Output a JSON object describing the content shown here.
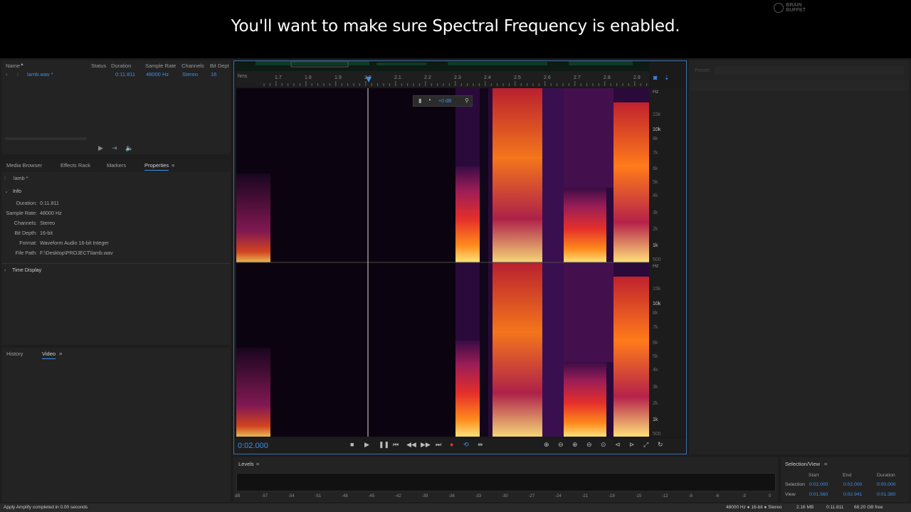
{
  "caption": "You'll want to make sure Spectral Frequency is enabled.",
  "logo": {
    "line1": "BRAIN",
    "line2": "BUFFET"
  },
  "files": {
    "columns": [
      "Name",
      "Status",
      "Duration",
      "Sample Rate",
      "Channels",
      "Bit Dept"
    ],
    "rows": [
      {
        "name": "lamb.wav *",
        "status": "",
        "duration": "0:11.811",
        "sample_rate": "48000 Hz",
        "channels": "Stereo",
        "bit_depth": "16"
      }
    ]
  },
  "tabs": [
    "Media Browser",
    "Effects Rack",
    "Markers",
    "Properties"
  ],
  "active_tab": "Properties",
  "properties": {
    "file_label": "lamb *",
    "info_header": "Info",
    "info": [
      {
        "label": "Duration:",
        "value": "0:11.811"
      },
      {
        "label": "Sample Rate:",
        "value": "48000 Hz"
      },
      {
        "label": "Channels:",
        "value": "Stereo"
      },
      {
        "label": "Bit Depth:",
        "value": "16-bit"
      },
      {
        "label": "Format:",
        "value": "Waveform Audio 16-bit Integer"
      },
      {
        "label": "File Path:",
        "value": "F:\\Desktop\\PROJECT\\lamb.wav"
      }
    ],
    "time_display": "Time Display"
  },
  "bottom_tabs": [
    "History",
    "Video"
  ],
  "ruler": {
    "unit": "hms",
    "ticks": [
      "1.7",
      "1.8",
      "1.9",
      "2.0",
      "2.1",
      "2.2",
      "2.3",
      "2.4",
      "2.5",
      "2.6",
      "2.7",
      "2.8",
      "2.9"
    ]
  },
  "hud": {
    "gain": "+0 dB"
  },
  "hz_axis": {
    "unit": "Hz",
    "ticks": [
      "15k",
      "10k",
      "8k",
      "7k",
      "6k",
      "5k",
      "4k",
      "3k",
      "2k",
      "1k",
      "500"
    ]
  },
  "timecode": "0:02.000",
  "right_panel": {
    "preset_label": "Preset:"
  },
  "levels": {
    "title": "Levels",
    "scale": [
      "dB",
      "-57",
      "-54",
      "-51",
      "-48",
      "-45",
      "-42",
      "-39",
      "-36",
      "-33",
      "-30",
      "-27",
      "-24",
      "-21",
      "-18",
      "-15",
      "-12",
      "-9",
      "-6",
      "-3",
      "0"
    ]
  },
  "selection_view": {
    "title": "Selection/View",
    "headers": [
      "Start",
      "End",
      "Duration"
    ],
    "rows": [
      {
        "label": "Selection",
        "start": "0:02.000",
        "end": "0:02.000",
        "duration": "0:00.000"
      },
      {
        "label": "View",
        "start": "0:01.560",
        "end": "0:02.941",
        "duration": "0:01.380"
      }
    ]
  },
  "status": {
    "left": "Apply Amplify completed in 0.00 seconds",
    "format": "48000 Hz ● 16-bit ● Stereo",
    "size": "2.16 MB",
    "duration": "0:11.811",
    "free": "68.20 GB free"
  },
  "colors": {
    "accent": "#3f8fe6",
    "panel": "#232323",
    "background": "#1d1d1d",
    "selection_border": "#3f6fa6"
  },
  "icons": [
    "play-icon",
    "stop-icon",
    "pause-icon",
    "skip-start-icon",
    "rewind-icon",
    "fast-forward-icon",
    "skip-end-icon",
    "record-icon",
    "loop-icon",
    "skip-selection-icon",
    "zoom-in-amplitude-icon",
    "zoom-out-amplitude-icon",
    "zoom-in-time-icon",
    "zoom-out-time-icon",
    "zoom-selection-icon",
    "zoom-full-icon"
  ]
}
